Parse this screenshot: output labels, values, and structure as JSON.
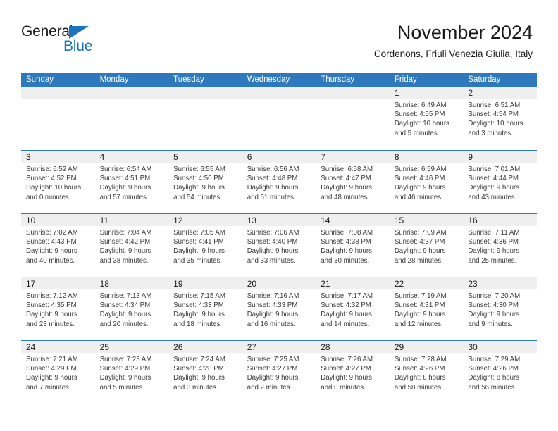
{
  "brand": {
    "name_top": "General",
    "name_bottom": "Blue",
    "triangle_icon": "blue-triangle-icon",
    "accent_color": "#1B74BD"
  },
  "header": {
    "title": "November 2024",
    "subtitle": "Cordenons, Friuli Venezia Giulia, Italy"
  },
  "theme": {
    "header_blue": "#2E78BE",
    "day_band_gray": "#EFEFEF",
    "text_color": "#3a3a3a"
  },
  "calendar": {
    "weekday_headers": [
      "Sunday",
      "Monday",
      "Tuesday",
      "Wednesday",
      "Thursday",
      "Friday",
      "Saturday"
    ],
    "weeks": [
      [
        {
          "day": "",
          "lines": []
        },
        {
          "day": "",
          "lines": []
        },
        {
          "day": "",
          "lines": []
        },
        {
          "day": "",
          "lines": []
        },
        {
          "day": "",
          "lines": []
        },
        {
          "day": "1",
          "lines": [
            "Sunrise: 6:49 AM",
            "Sunset: 4:55 PM",
            "Daylight: 10 hours",
            "and 5 minutes."
          ]
        },
        {
          "day": "2",
          "lines": [
            "Sunrise: 6:51 AM",
            "Sunset: 4:54 PM",
            "Daylight: 10 hours",
            "and 3 minutes."
          ]
        }
      ],
      [
        {
          "day": "3",
          "lines": [
            "Sunrise: 6:52 AM",
            "Sunset: 4:52 PM",
            "Daylight: 10 hours",
            "and 0 minutes."
          ]
        },
        {
          "day": "4",
          "lines": [
            "Sunrise: 6:54 AM",
            "Sunset: 4:51 PM",
            "Daylight: 9 hours",
            "and 57 minutes."
          ]
        },
        {
          "day": "5",
          "lines": [
            "Sunrise: 6:55 AM",
            "Sunset: 4:50 PM",
            "Daylight: 9 hours",
            "and 54 minutes."
          ]
        },
        {
          "day": "6",
          "lines": [
            "Sunrise: 6:56 AM",
            "Sunset: 4:48 PM",
            "Daylight: 9 hours",
            "and 51 minutes."
          ]
        },
        {
          "day": "7",
          "lines": [
            "Sunrise: 6:58 AM",
            "Sunset: 4:47 PM",
            "Daylight: 9 hours",
            "and 48 minutes."
          ]
        },
        {
          "day": "8",
          "lines": [
            "Sunrise: 6:59 AM",
            "Sunset: 4:46 PM",
            "Daylight: 9 hours",
            "and 46 minutes."
          ]
        },
        {
          "day": "9",
          "lines": [
            "Sunrise: 7:01 AM",
            "Sunset: 4:44 PM",
            "Daylight: 9 hours",
            "and 43 minutes."
          ]
        }
      ],
      [
        {
          "day": "10",
          "lines": [
            "Sunrise: 7:02 AM",
            "Sunset: 4:43 PM",
            "Daylight: 9 hours",
            "and 40 minutes."
          ]
        },
        {
          "day": "11",
          "lines": [
            "Sunrise: 7:04 AM",
            "Sunset: 4:42 PM",
            "Daylight: 9 hours",
            "and 38 minutes."
          ]
        },
        {
          "day": "12",
          "lines": [
            "Sunrise: 7:05 AM",
            "Sunset: 4:41 PM",
            "Daylight: 9 hours",
            "and 35 minutes."
          ]
        },
        {
          "day": "13",
          "lines": [
            "Sunrise: 7:06 AM",
            "Sunset: 4:40 PM",
            "Daylight: 9 hours",
            "and 33 minutes."
          ]
        },
        {
          "day": "14",
          "lines": [
            "Sunrise: 7:08 AM",
            "Sunset: 4:38 PM",
            "Daylight: 9 hours",
            "and 30 minutes."
          ]
        },
        {
          "day": "15",
          "lines": [
            "Sunrise: 7:09 AM",
            "Sunset: 4:37 PM",
            "Daylight: 9 hours",
            "and 28 minutes."
          ]
        },
        {
          "day": "16",
          "lines": [
            "Sunrise: 7:11 AM",
            "Sunset: 4:36 PM",
            "Daylight: 9 hours",
            "and 25 minutes."
          ]
        }
      ],
      [
        {
          "day": "17",
          "lines": [
            "Sunrise: 7:12 AM",
            "Sunset: 4:35 PM",
            "Daylight: 9 hours",
            "and 23 minutes."
          ]
        },
        {
          "day": "18",
          "lines": [
            "Sunrise: 7:13 AM",
            "Sunset: 4:34 PM",
            "Daylight: 9 hours",
            "and 20 minutes."
          ]
        },
        {
          "day": "19",
          "lines": [
            "Sunrise: 7:15 AM",
            "Sunset: 4:33 PM",
            "Daylight: 9 hours",
            "and 18 minutes."
          ]
        },
        {
          "day": "20",
          "lines": [
            "Sunrise: 7:16 AM",
            "Sunset: 4:33 PM",
            "Daylight: 9 hours",
            "and 16 minutes."
          ]
        },
        {
          "day": "21",
          "lines": [
            "Sunrise: 7:17 AM",
            "Sunset: 4:32 PM",
            "Daylight: 9 hours",
            "and 14 minutes."
          ]
        },
        {
          "day": "22",
          "lines": [
            "Sunrise: 7:19 AM",
            "Sunset: 4:31 PM",
            "Daylight: 9 hours",
            "and 12 minutes."
          ]
        },
        {
          "day": "23",
          "lines": [
            "Sunrise: 7:20 AM",
            "Sunset: 4:30 PM",
            "Daylight: 9 hours",
            "and 9 minutes."
          ]
        }
      ],
      [
        {
          "day": "24",
          "lines": [
            "Sunrise: 7:21 AM",
            "Sunset: 4:29 PM",
            "Daylight: 9 hours",
            "and 7 minutes."
          ]
        },
        {
          "day": "25",
          "lines": [
            "Sunrise: 7:23 AM",
            "Sunset: 4:29 PM",
            "Daylight: 9 hours",
            "and 5 minutes."
          ]
        },
        {
          "day": "26",
          "lines": [
            "Sunrise: 7:24 AM",
            "Sunset: 4:28 PM",
            "Daylight: 9 hours",
            "and 3 minutes."
          ]
        },
        {
          "day": "27",
          "lines": [
            "Sunrise: 7:25 AM",
            "Sunset: 4:27 PM",
            "Daylight: 9 hours",
            "and 2 minutes."
          ]
        },
        {
          "day": "28",
          "lines": [
            "Sunrise: 7:26 AM",
            "Sunset: 4:27 PM",
            "Daylight: 9 hours",
            "and 0 minutes."
          ]
        },
        {
          "day": "29",
          "lines": [
            "Sunrise: 7:28 AM",
            "Sunset: 4:26 PM",
            "Daylight: 8 hours",
            "and 58 minutes."
          ]
        },
        {
          "day": "30",
          "lines": [
            "Sunrise: 7:29 AM",
            "Sunset: 4:26 PM",
            "Daylight: 8 hours",
            "and 56 minutes."
          ]
        }
      ]
    ]
  }
}
